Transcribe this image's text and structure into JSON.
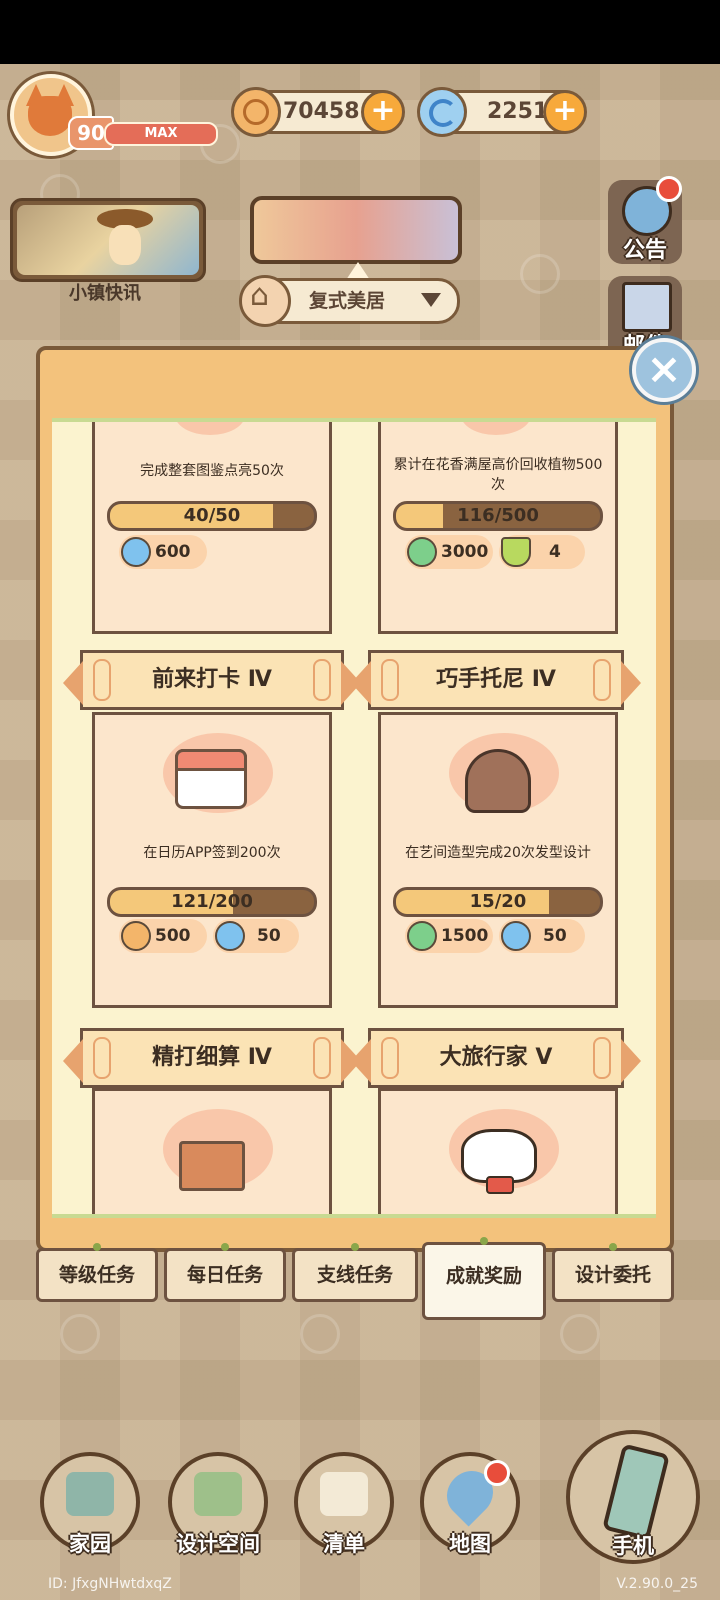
{
  "hud": {
    "level": "90",
    "level_bar_label": "MAX",
    "coins": "70458",
    "gems": "2251",
    "plus": "+",
    "news_label": "小镇快讯",
    "location": "复式美居",
    "side_buttons": [
      "公告",
      "邮件"
    ]
  },
  "panel": {
    "close": "×",
    "cards": [
      {
        "title": "",
        "desc": "完成整套图鉴点亮50次",
        "progress": "40/50",
        "progress_value": 0.8,
        "rewards": [
          {
            "icon": "gem-icon",
            "value": "600"
          }
        ]
      },
      {
        "title": "",
        "desc": "累计在花香满屋高价回收植物500次",
        "progress": "116/500",
        "progress_value": 0.232,
        "rewards": [
          {
            "icon": "clover-icon",
            "value": "3000"
          },
          {
            "icon": "potion-icon",
            "value": "4"
          }
        ]
      },
      {
        "title": "前来打卡 Ⅳ",
        "desc": "在日历APP签到200次",
        "progress": "121/200",
        "progress_value": 0.605,
        "rewards": [
          {
            "icon": "coin-icon",
            "value": "500"
          },
          {
            "icon": "gem-icon",
            "value": "50"
          }
        ]
      },
      {
        "title": "巧手托尼 Ⅳ",
        "desc": "在艺间造型完成20次发型设计",
        "progress": "15/20",
        "progress_value": 0.75,
        "rewards": [
          {
            "icon": "clover-icon",
            "value": "1500"
          },
          {
            "icon": "gem-icon",
            "value": "50"
          }
        ]
      },
      {
        "title": "精打细算 Ⅳ",
        "icon": "box-icon"
      },
      {
        "title": "大旅行家 Ⅴ",
        "icon": "cat-icon"
      }
    ]
  },
  "tabs": [
    {
      "label": "等级任务",
      "active": false
    },
    {
      "label": "每日任务",
      "active": false
    },
    {
      "label": "支线任务",
      "active": false
    },
    {
      "label": "成就奖励",
      "active": true
    },
    {
      "label": "设计委托",
      "active": false
    }
  ],
  "bottom_nav": [
    "家园",
    "设计空间",
    "清单",
    "地图",
    "手机"
  ],
  "footer": {
    "id": "ID: JfxgNHwtdxqZ",
    "version": "V.2.90.0_25"
  },
  "colors": {
    "panel_bg": "#f3c27c",
    "card_bg": "#fce6cc",
    "progress_fill": "#f4c87a",
    "progress_track": "#8a6340",
    "notify_red": "#e84d3b"
  }
}
